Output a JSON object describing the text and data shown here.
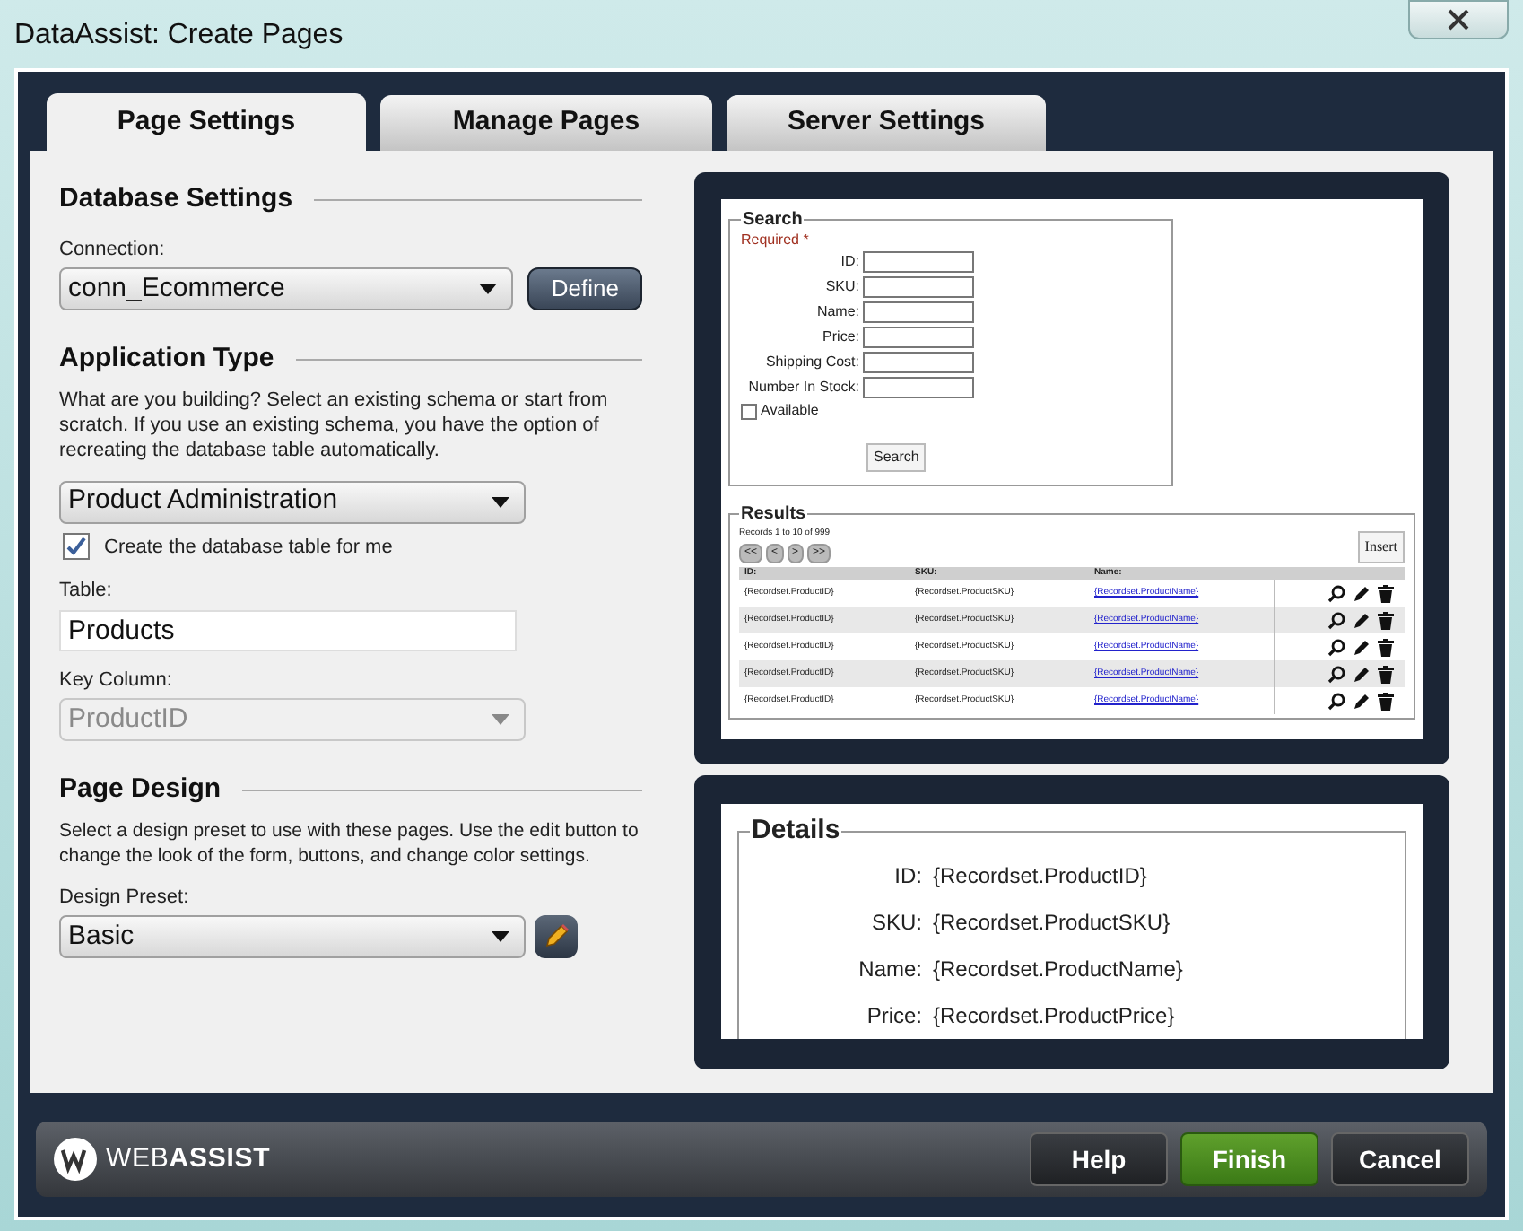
{
  "window": {
    "title": "DataAssist: Create Pages"
  },
  "tabs": [
    {
      "label": "Page Settings",
      "selected": true
    },
    {
      "label": "Manage Pages",
      "selected": false
    },
    {
      "label": "Server Settings",
      "selected": false
    }
  ],
  "database_settings": {
    "heading": "Database Settings",
    "connection_label": "Connection:",
    "connection_value": "conn_Ecommerce",
    "define_button": "Define"
  },
  "application_type": {
    "heading": "Application Type",
    "description": "What are you building? Select an existing schema or start from scratch. If you use an existing schema, you have the option of recreating the database table automatically.",
    "value": "Product Administration",
    "create_table": {
      "label": "Create the database table for me",
      "checked": true
    },
    "table_label": "Table:",
    "table_value": "Products",
    "key_column_label": "Key Column:",
    "key_column_value": "ProductID",
    "key_column_disabled": true
  },
  "page_design": {
    "heading": "Page Design",
    "description": "Select a design preset to use with these pages. Use the edit button to change the look of the form, buttons, and change color settings.",
    "preset_label": "Design Preset:",
    "preset_value": "Basic"
  },
  "search_preview": {
    "legend": "Search",
    "required": "Required *",
    "fields": [
      "ID:",
      "SKU:",
      "Name:",
      "Price:",
      "Shipping Cost:",
      "Number In Stock:"
    ],
    "available": {
      "label": "Available",
      "checked": false
    },
    "button": "Search"
  },
  "results_preview": {
    "legend": "Results",
    "records": "Records 1 to 10 of 999",
    "pager": [
      "<<",
      "<",
      ">",
      ">>"
    ],
    "insert_button": "Insert",
    "columns": [
      "ID:",
      "SKU:",
      "Name:"
    ],
    "rows": [
      [
        "{Recordset.ProductID}",
        "{Recordset.ProductSKU}",
        "{Recordset.ProductName}"
      ],
      [
        "{Recordset.ProductID}",
        "{Recordset.ProductSKU}",
        "{Recordset.ProductName}"
      ],
      [
        "{Recordset.ProductID}",
        "{Recordset.ProductSKU}",
        "{Recordset.ProductName}"
      ],
      [
        "{Recordset.ProductID}",
        "{Recordset.ProductSKU}",
        "{Recordset.ProductName}"
      ],
      [
        "{Recordset.ProductID}",
        "{Recordset.ProductSKU}",
        "{Recordset.ProductName}"
      ]
    ]
  },
  "details_preview": {
    "legend": "Details",
    "rows": [
      {
        "label": "ID:",
        "value": "{Recordset.ProductID}"
      },
      {
        "label": "SKU:",
        "value": "{Recordset.ProductSKU}"
      },
      {
        "label": "Name:",
        "value": "{Recordset.ProductName}"
      },
      {
        "label": "Price:",
        "value": "{Recordset.ProductPrice}"
      }
    ]
  },
  "footer": {
    "logo": "WEB**ASSIST**",
    "buttons": [
      {
        "label": "Help",
        "kind": "default"
      },
      {
        "label": "Finish",
        "kind": "primary"
      },
      {
        "label": "Cancel",
        "kind": "default"
      }
    ]
  }
}
